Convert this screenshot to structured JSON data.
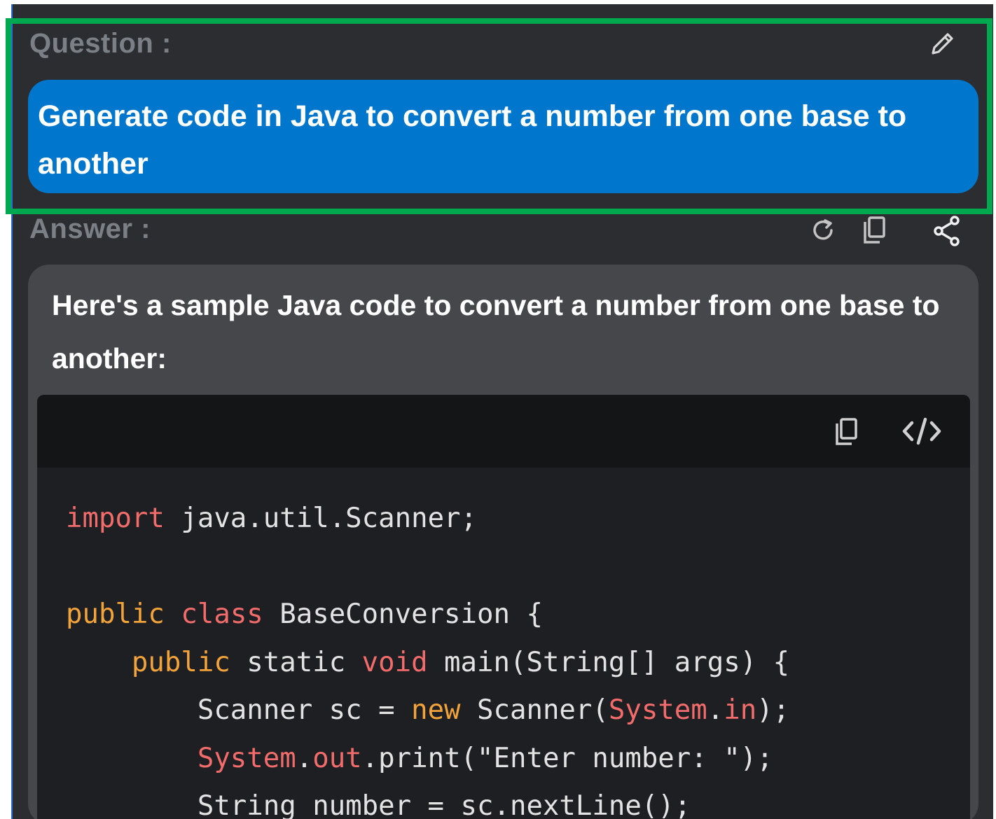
{
  "question": {
    "label": "Question :",
    "text": "Generate code in Java to convert a number from one base to another",
    "edit_icon": "pencil-icon"
  },
  "answer": {
    "label": "Answer :",
    "icons": [
      "refresh-icon",
      "copy-icon",
      "share-icon"
    ],
    "intro": "Here's a sample Java code to convert a number from one base to another:"
  },
  "code_block": {
    "header_icons": [
      "copy-icon",
      "code-icon"
    ],
    "lines": [
      [
        {
          "t": "import",
          "c": "red"
        },
        {
          "t": " java.util.Scanner;",
          "c": "plain"
        }
      ],
      [],
      [
        {
          "t": "public",
          "c": "orange"
        },
        {
          "t": " ",
          "c": "plain"
        },
        {
          "t": "class",
          "c": "red"
        },
        {
          "t": " BaseConversion {",
          "c": "plain"
        }
      ],
      [
        {
          "t": "    ",
          "c": "plain"
        },
        {
          "t": "public",
          "c": "orange"
        },
        {
          "t": " static ",
          "c": "plain"
        },
        {
          "t": "void",
          "c": "red"
        },
        {
          "t": " main(String[] args) {",
          "c": "plain"
        }
      ],
      [
        {
          "t": "        Scanner sc = ",
          "c": "plain"
        },
        {
          "t": "new",
          "c": "orange"
        },
        {
          "t": " Scanner(",
          "c": "plain"
        },
        {
          "t": "System",
          "c": "red"
        },
        {
          "t": ".",
          "c": "plain"
        },
        {
          "t": "in",
          "c": "red"
        },
        {
          "t": ");",
          "c": "plain"
        }
      ],
      [
        {
          "t": "        ",
          "c": "plain"
        },
        {
          "t": "System",
          "c": "red"
        },
        {
          "t": ".",
          "c": "plain"
        },
        {
          "t": "out",
          "c": "red"
        },
        {
          "t": ".print(\"Enter number: \");",
          "c": "plain"
        }
      ],
      [
        {
          "t": "        String number = sc.nextLine();",
          "c": "plain"
        }
      ]
    ]
  },
  "colors": {
    "panel": "#2b2d30",
    "question_bubble": "#0077cc",
    "answer_bubble": "#45474b",
    "highlight": "#00a84f",
    "keyword_red": "#f26c6c",
    "keyword_orange": "#f2a33a"
  }
}
